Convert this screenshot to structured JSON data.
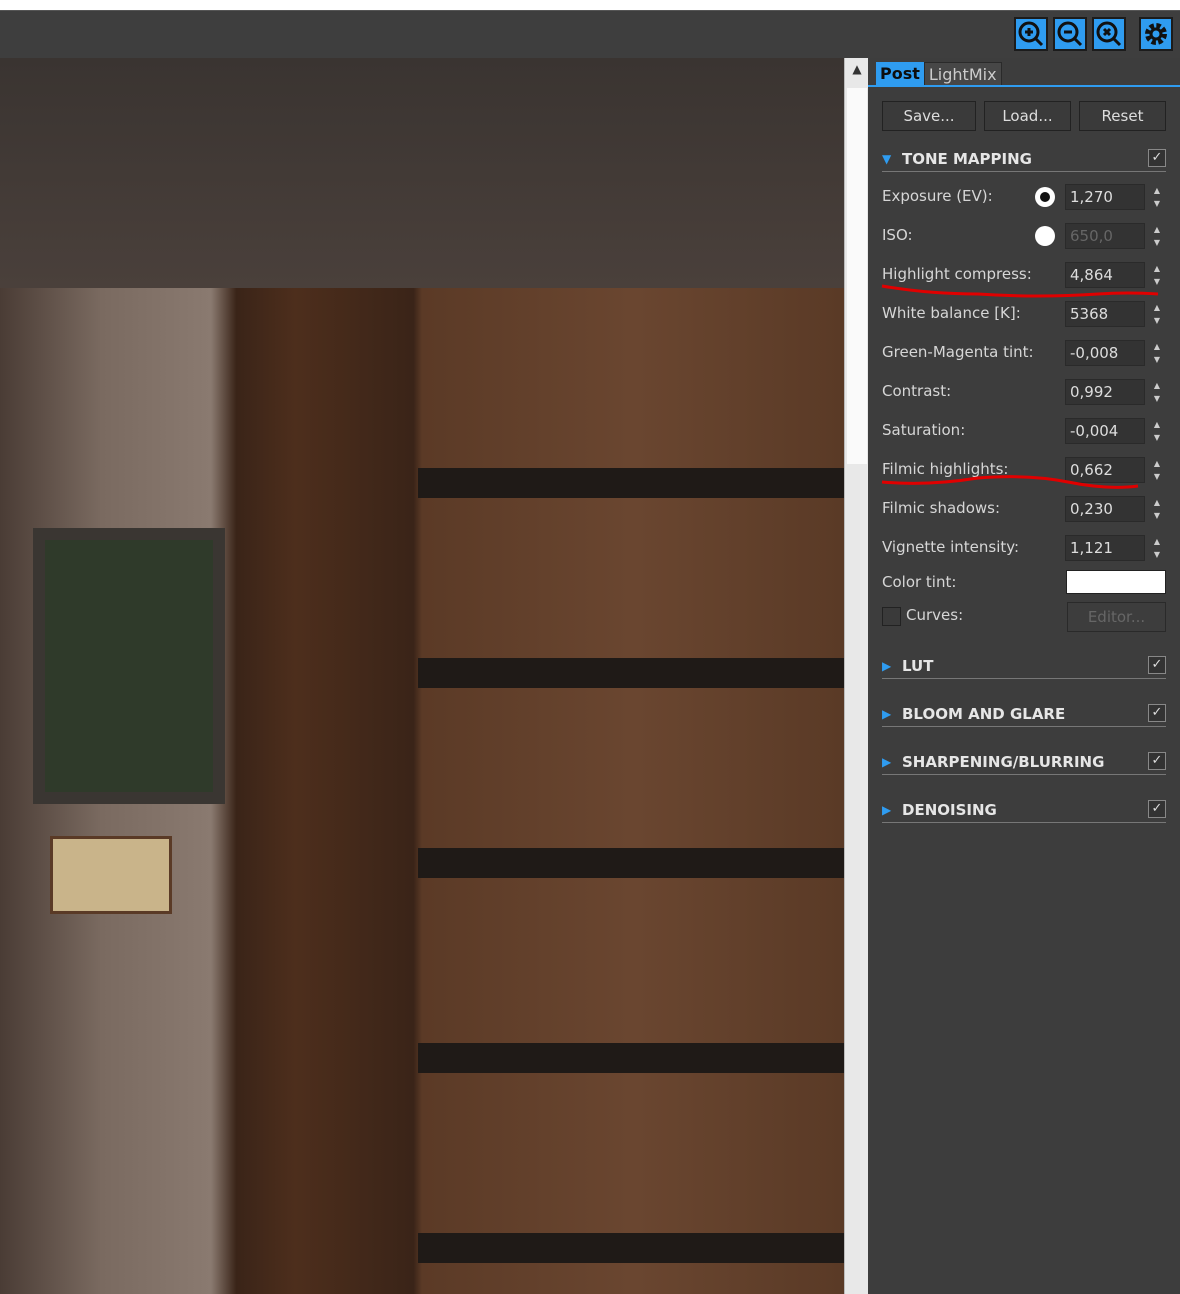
{
  "toolbar": {
    "buttons": [
      "zoom-in",
      "zoom-out",
      "zoom-reset",
      "settings"
    ]
  },
  "tabs": [
    {
      "label": "Post",
      "active": true
    },
    {
      "label": "LightMix",
      "active": false
    }
  ],
  "actions": {
    "save": "Save...",
    "load": "Load...",
    "reset": "Reset"
  },
  "tone_mapping": {
    "title": "TONE MAPPING",
    "enabled": true,
    "exposure": {
      "label": "Exposure (EV):",
      "value": "1,270"
    },
    "iso": {
      "label": "ISO:",
      "value": "650,0"
    },
    "highlight_compress": {
      "label": "Highlight compress:",
      "value": "4,864"
    },
    "white_balance": {
      "label": "White balance [K]:",
      "value": "5368"
    },
    "green_magenta": {
      "label": "Green-Magenta tint:",
      "value": "-0,008"
    },
    "contrast": {
      "label": "Contrast:",
      "value": "0,992"
    },
    "saturation": {
      "label": "Saturation:",
      "value": "-0,004"
    },
    "filmic_highlights": {
      "label": "Filmic highlights:",
      "value": "0,662"
    },
    "filmic_shadows": {
      "label": "Filmic shadows:",
      "value": "0,230"
    },
    "vignette": {
      "label": "Vignette intensity:",
      "value": "1,121"
    },
    "color_tint": {
      "label": "Color tint:",
      "color": "#ffffff"
    },
    "curves": {
      "label": "Curves:",
      "checked": false,
      "editor": "Editor..."
    }
  },
  "sections": [
    {
      "title": "LUT",
      "enabled": true
    },
    {
      "title": "BLOOM AND GLARE",
      "enabled": true
    },
    {
      "title": "SHARPENING/BLURRING",
      "enabled": true
    },
    {
      "title": "DENOISING",
      "enabled": true
    }
  ],
  "colors": {
    "accent": "#2f9cf0",
    "panel": "#3d3d3d",
    "annotation": "#e00000"
  }
}
